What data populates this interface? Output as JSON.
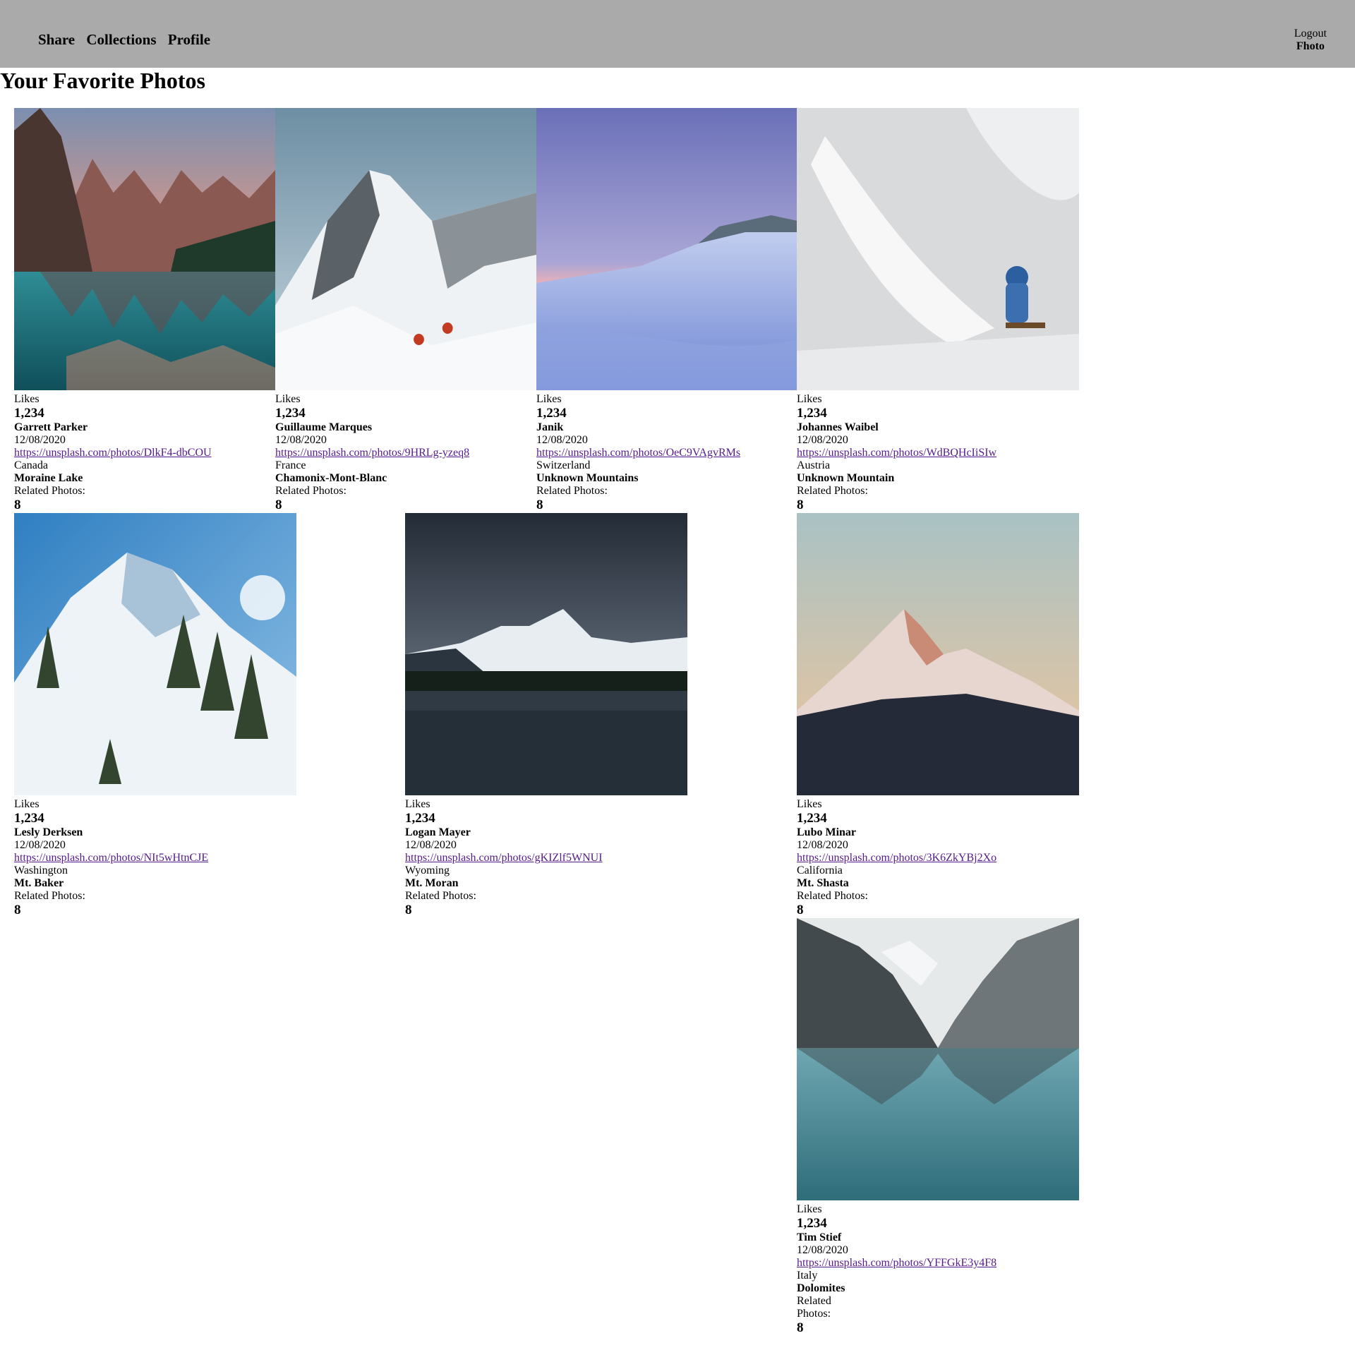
{
  "nav": {
    "items": [
      "Share",
      "Collections",
      "Profile"
    ],
    "logout": "Logout",
    "user": "Fhoto"
  },
  "page": {
    "title": "Your Favorite Photos"
  },
  "labels": {
    "likes": "Likes",
    "related": "Related Photos:",
    "related_split_1": "Related",
    "related_split_2": "Photos:"
  },
  "photos": [
    {
      "likes": "1,234",
      "author": "Garrett Parker",
      "date": "12/08/2020",
      "url": "https://unsplash.com/photos/DlkF4-dbCOU",
      "region": "Canada",
      "place": "Moraine Lake",
      "related": "8",
      "scene": "lake-sunset"
    },
    {
      "likes": "1,234",
      "author": "Guillaume Marques",
      "date": "12/08/2020",
      "url": "https://unsplash.com/photos/9HRLg-yzeq8",
      "region": "France",
      "place": "Chamonix-Mont-Blanc",
      "related": "8",
      "scene": "snow-peak-climbers"
    },
    {
      "likes": "1,234",
      "author": "Janik",
      "date": "12/08/2020",
      "url": "https://unsplash.com/photos/OeC9VAgvRMs",
      "region": "Switzerland",
      "place": "Unknown Mountains",
      "related": "8",
      "scene": "snow-field-dusk"
    },
    {
      "likes": "1,234",
      "author": "Johannes Waibel",
      "date": "12/08/2020",
      "url": "https://unsplash.com/photos/WdBQHcIiSIw",
      "region": "Austria",
      "place": "Unknown Mountain",
      "related": "8",
      "scene": "snowboard-spray"
    },
    {
      "likes": "1,234",
      "author": "Lesly Derksen",
      "date": "12/08/2020",
      "url": "https://unsplash.com/photos/NIt5wHtnCJE",
      "region": "Washington",
      "place": "Mt. Baker",
      "related": "8",
      "scene": "snowy-ridge-trees"
    },
    {
      "likes": "1,234",
      "author": "Logan Mayer",
      "date": "12/08/2020",
      "url": "https://unsplash.com/photos/gKIZlf5WNUI",
      "region": "Wyoming",
      "place": "Mt. Moran",
      "related": "8",
      "scene": "stormy-lake"
    },
    {
      "likes": "1,234",
      "author": "Lubo Minar",
      "date": "12/08/2020",
      "url": "https://unsplash.com/photos/3K6ZkYBj2Xo",
      "region": "California",
      "place": "Mt. Shasta",
      "related": "8",
      "scene": "lone-peak-dusk"
    },
    {
      "likes": "1,234",
      "author": "Tim Stief",
      "date": "12/08/2020",
      "url": "https://unsplash.com/photos/YFFGkE3y4F8",
      "region": "Italy",
      "place": "Dolomites",
      "related": "8",
      "scene": "valley-lake-reflection"
    }
  ]
}
